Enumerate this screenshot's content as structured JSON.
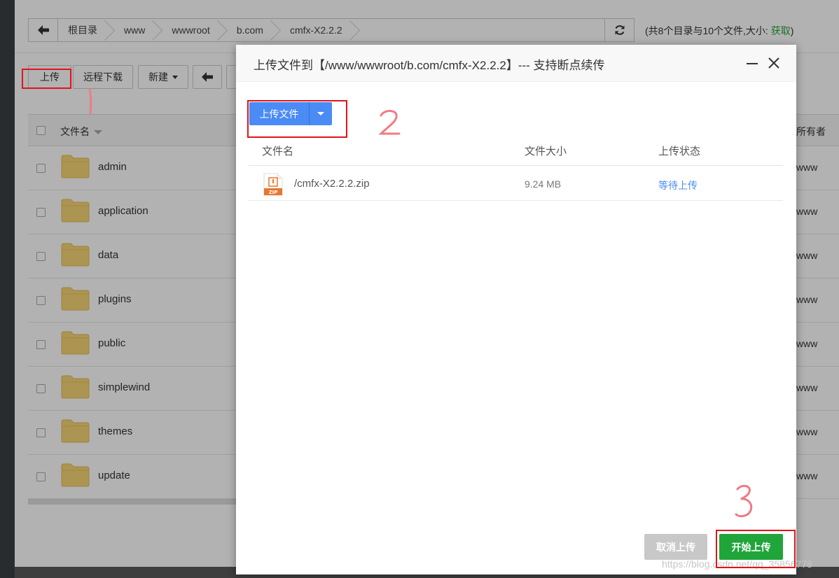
{
  "pathbar": {
    "crumbs": [
      "根目录",
      "www",
      "wwwroot",
      "b.com",
      "cmfx-X2.2.2"
    ],
    "summary_text": "(共8个目录与10个文件,大小: ",
    "summary_link": "获取",
    "summary_end": ")"
  },
  "toolbar": {
    "upload": "上传",
    "remote_download": "远程下载",
    "new": "新建"
  },
  "file_table": {
    "col_name": "文件名",
    "col_owner": "所有者",
    "rows": [
      {
        "name": "admin",
        "owner": "www"
      },
      {
        "name": "application",
        "owner": "www"
      },
      {
        "name": "data",
        "owner": "www"
      },
      {
        "name": "plugins",
        "owner": "www"
      },
      {
        "name": "public",
        "owner": "www"
      },
      {
        "name": "simplewind",
        "owner": "www"
      },
      {
        "name": "themes",
        "owner": "www"
      },
      {
        "name": "update",
        "owner": "www"
      }
    ]
  },
  "modal": {
    "title": "上传文件到【/www/wwwroot/b.com/cmfx-X2.2.2】--- 支持断点续传",
    "upload_files": "上传文件",
    "col_name": "文件名",
    "col_size": "文件大小",
    "col_status": "上传状态",
    "file": {
      "name": "/cmfx-X2.2.2.zip",
      "size": "9.24 MB",
      "status": "等待上传",
      "badge": "ZIP"
    },
    "cancel": "取消上传",
    "start": "开始上传"
  },
  "watermark": "https://blog.csdn.net/qq_35856778",
  "colors": {
    "accent_green": "#20a53a",
    "accent_blue": "#4a8bf5",
    "annotation_red": "#e0141c"
  }
}
